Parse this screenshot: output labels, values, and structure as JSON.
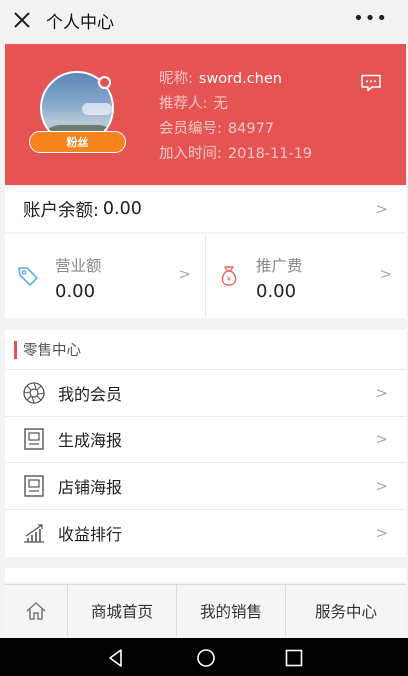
{
  "header": {
    "title": "个人中心",
    "more_label": "•••"
  },
  "profile": {
    "badge": "粉丝",
    "nickname_label": "昵称:",
    "nickname": "sword.chen",
    "referrer_label": "推荐人:",
    "referrer": "无",
    "member_no_label": "会员编号:",
    "member_no": "84977",
    "join_label": "加入时间:",
    "join_date": "2018-11-19"
  },
  "account": {
    "balance_label": "账户余额:",
    "balance": "0.00"
  },
  "stats": [
    {
      "label": "营业额",
      "value": "0.00",
      "icon": "tag-icon"
    },
    {
      "label": "推广费",
      "value": "0.00",
      "icon": "money-bag-icon"
    }
  ],
  "retail": {
    "title": "零售中心",
    "items": [
      {
        "label": "我的会员",
        "icon": "aperture-icon"
      },
      {
        "label": "生成海报",
        "icon": "poster-icon"
      },
      {
        "label": "店铺海报",
        "icon": "poster-icon"
      },
      {
        "label": "收益排行",
        "icon": "ranking-chart-icon"
      }
    ]
  },
  "chevron": ">",
  "bottom_nav": {
    "home_icon": "home-icon",
    "items": [
      "商城首页",
      "我的销售",
      "服务中心"
    ]
  },
  "colors": {
    "brand_red": "#e55453",
    "badge_orange": "#f5841f",
    "tag_blue": "#5bb3e0",
    "bag_red": "#e36a5f"
  }
}
